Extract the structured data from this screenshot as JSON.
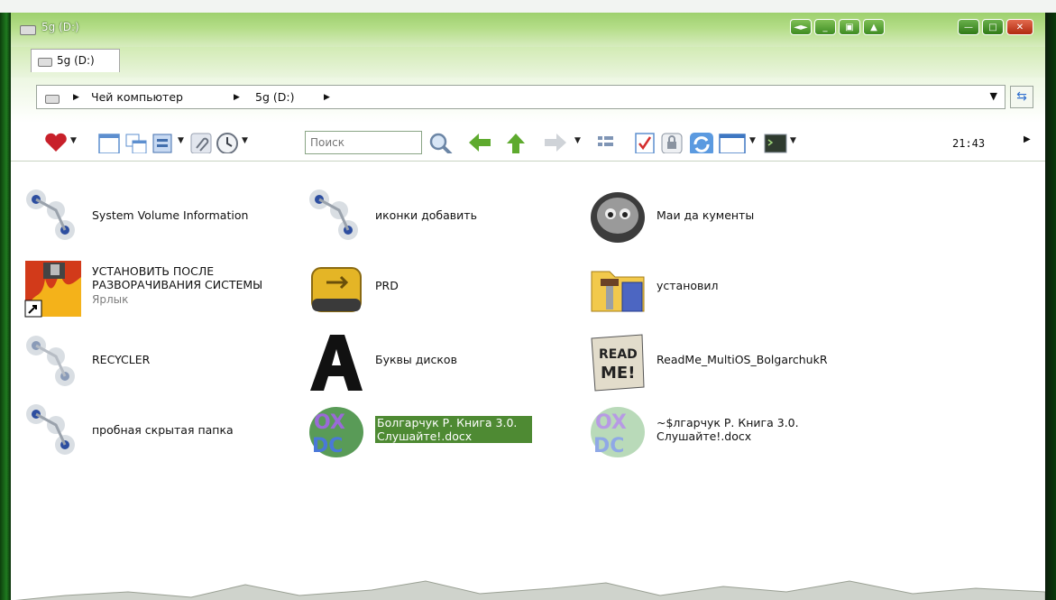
{
  "window": {
    "title": "5g (D:)",
    "tab_label": "5g (D:)",
    "buttons": [
      "◄►",
      "_",
      "▣",
      "▲"
    ]
  },
  "address": {
    "crumbs": [
      "Чей компьютер",
      "5g (D:)"
    ]
  },
  "toolbar": {
    "search_placeholder": "Поиск",
    "clock": "21:43"
  },
  "items": [
    {
      "name": "System Volume Information",
      "icon": "hidden-folder-icon"
    },
    {
      "name": "иконки добавить",
      "icon": "hidden-folder-icon"
    },
    {
      "name": "Маи да кументы",
      "icon": "gray-face-icon"
    },
    {
      "name": "УСТАНОВИТЬ ПОСЛЕ РАЗВОРАЧИВАНИЯ СИСТЕМЫ",
      "sub": "Ярлык",
      "icon": "shortcut-fire-icon"
    },
    {
      "name": "PRD",
      "icon": "usb-drive-icon"
    },
    {
      "name": "установил",
      "icon": "folder-tools-icon"
    },
    {
      "name": "RECYCLER",
      "icon": "hidden-folder-icon"
    },
    {
      "name": "Буквы дисков",
      "icon": "letter-a-icon"
    },
    {
      "name": "ReadMe_MultiOS_BolgarchukR",
      "icon": "readme-paper-icon"
    },
    {
      "name": "пробная скрытая папка",
      "icon": "hidden-folder-icon"
    },
    {
      "name": "Болгарчук Р.  Книга 3.0. Слушайте!.docx",
      "icon": "docx-graffiti-icon",
      "selected": true
    },
    {
      "name": "~$лгарчук Р.  Книга 3.0. Слушайте!.docx",
      "icon": "docx-graffiti-faded-icon"
    }
  ],
  "colors": {
    "titlebar": "#9ed06e",
    "selection": "#4e8a33",
    "accent_green": "#3e8c22"
  }
}
